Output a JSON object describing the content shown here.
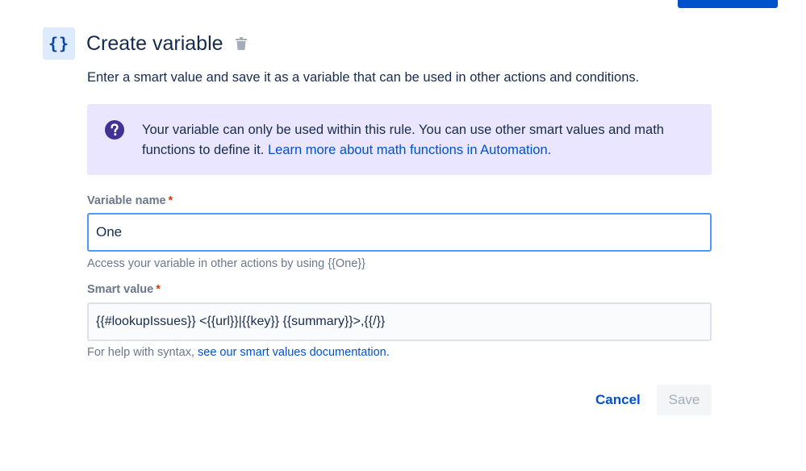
{
  "header": {
    "icon_glyph": "{}",
    "icon_name": "curly-braces-icon",
    "title": "Create variable",
    "delete_icon": "trash-icon"
  },
  "description": "Enter a smart value and save it as a variable that can be used in other actions and conditions.",
  "info": {
    "icon": "question-circle-icon",
    "text": "Your variable can only be used within this rule. You can use other smart values and math functions to define it. ",
    "link_text": "Learn more about math functions in Automation."
  },
  "variable_name": {
    "label": "Variable name",
    "required_marker": "*",
    "value": "One",
    "helper": "Access your variable in other actions by using {{One}}"
  },
  "smart_value": {
    "label": "Smart value",
    "required_marker": "*",
    "value": "{{#lookupIssues}} <{{url}}|{{key}} {{summary}}>,{{/}}",
    "helper_prefix": "For help with syntax, ",
    "helper_link": "see our smart values documentation."
  },
  "actions": {
    "cancel_label": "Cancel",
    "save_label": "Save"
  },
  "colors": {
    "primary": "#0052cc",
    "focus_border": "#4c9aff",
    "info_bg": "#eae6ff",
    "info_icon": "#403294",
    "required": "#de350b"
  }
}
